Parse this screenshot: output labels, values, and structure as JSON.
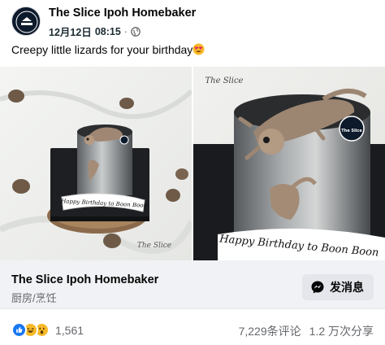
{
  "post": {
    "author": "The Slice Ipoh Homebaker",
    "date": "12月12日",
    "time": "08:15",
    "separator": "·",
    "privacy_icon": "globe-icon",
    "caption": "Creepy little lizards for your birthday",
    "caption_emoji": "heart-eyes-emoji",
    "avatar_text": "The Slice"
  },
  "photos": {
    "left_plaque_text": "Happy Birthday to Boon Boon",
    "left_watermark": "The Slice",
    "right_watermark": "The Slice",
    "right_plaque_text": "Happy Birthday to Boon Boon",
    "badge_text": "The Slice"
  },
  "page_card": {
    "title": "The Slice Ipoh Homebaker",
    "category": "厨房/烹饪",
    "message_button": "发消息",
    "message_icon": "messenger-icon"
  },
  "engagement": {
    "reactions": [
      "like-icon",
      "haha-icon",
      "wow-icon"
    ],
    "reaction_count": "1,561",
    "comments": "7,229条评论",
    "shares": "1.2 万次分享"
  },
  "colors": {
    "accent": "#1877f2",
    "secondary_text": "#65676b",
    "card_bg": "#f0f2f5"
  }
}
